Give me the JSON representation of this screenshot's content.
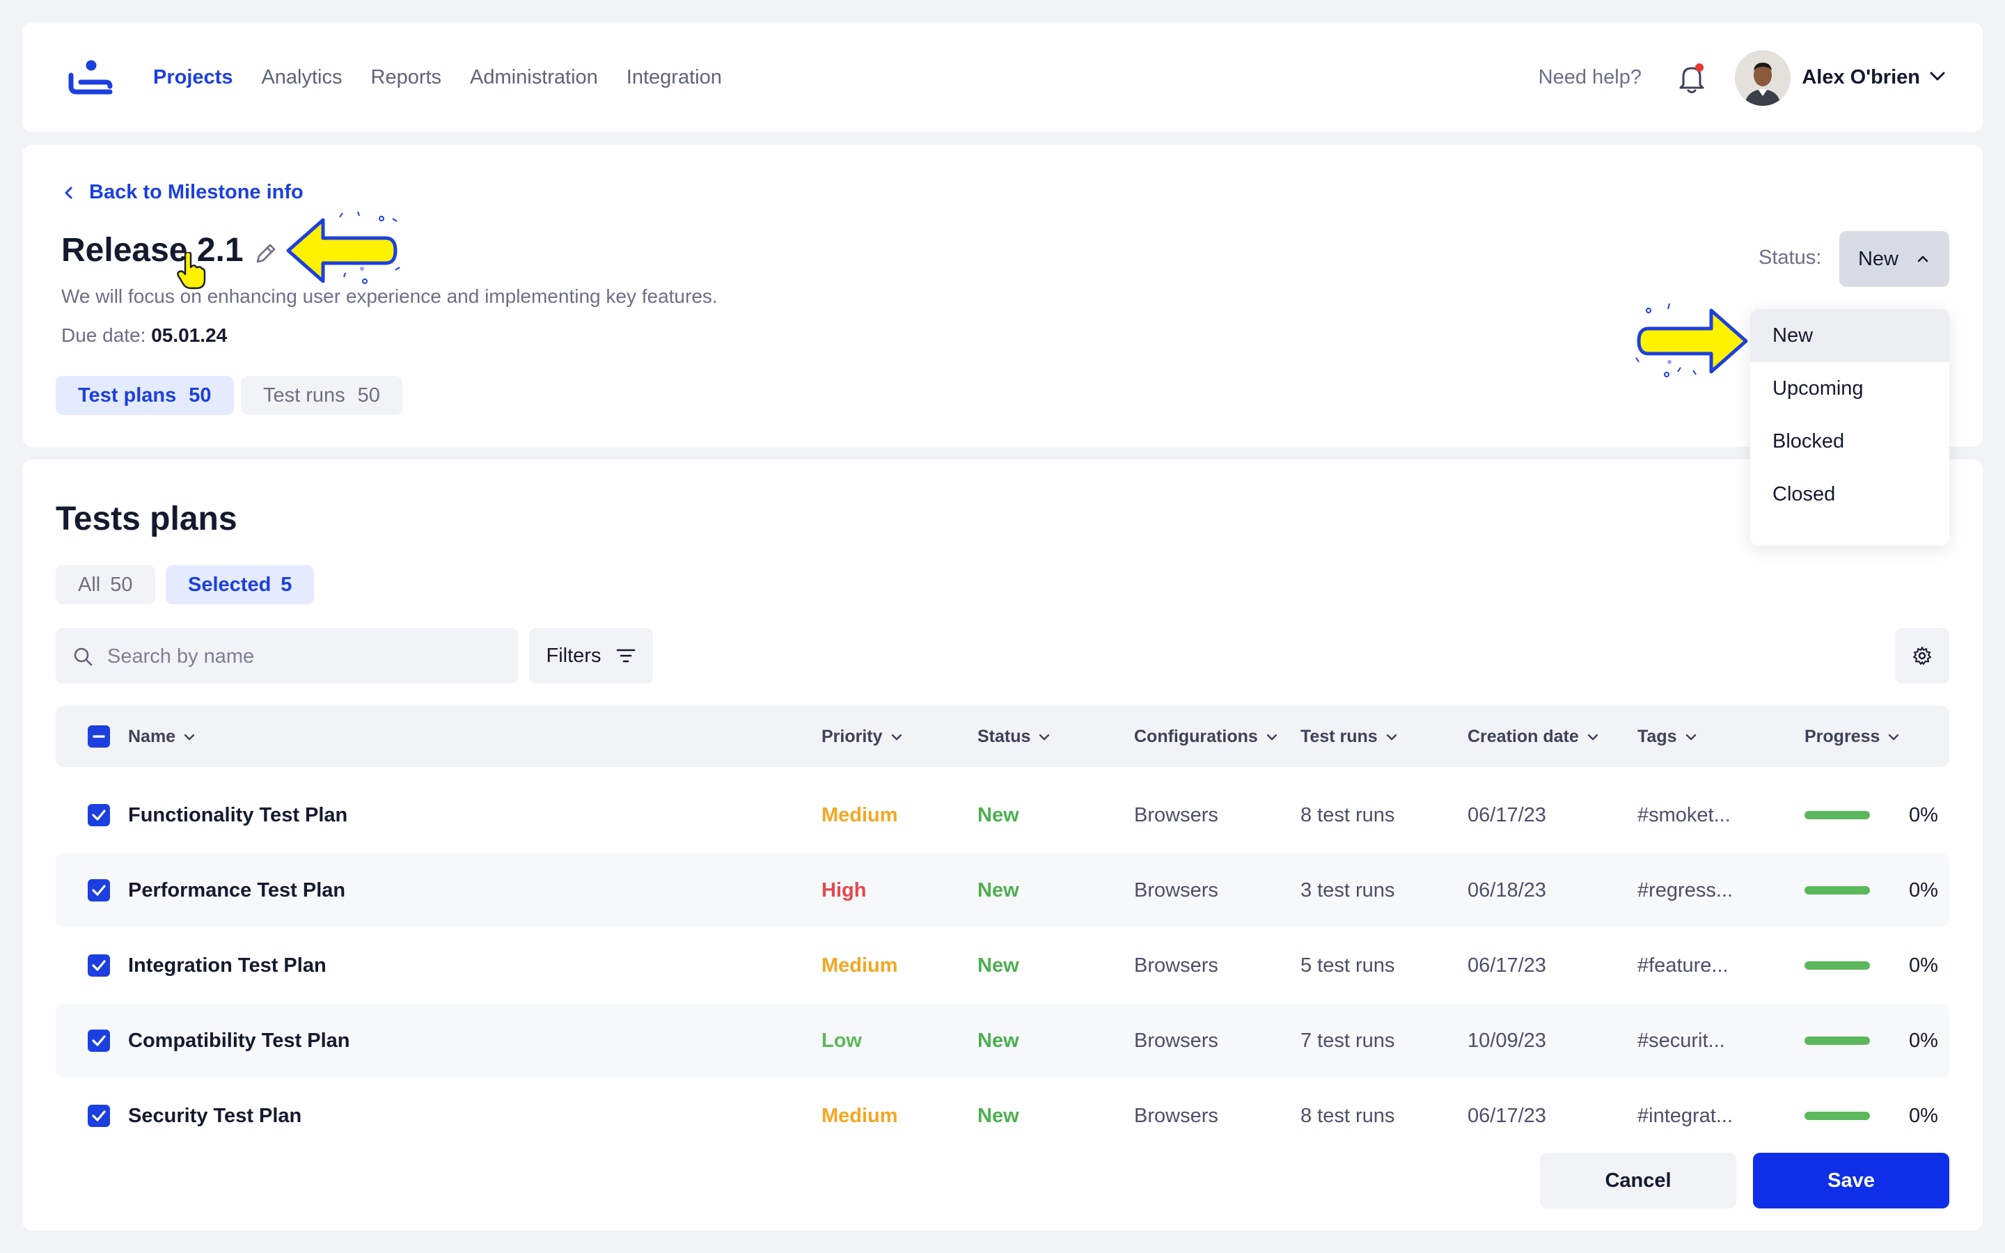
{
  "nav": {
    "items": [
      "Projects",
      "Analytics",
      "Reports",
      "Administration",
      "Integration"
    ],
    "active": "Projects"
  },
  "header": {
    "help": "Need help?",
    "user_name": "Alex O'brien",
    "notification_dot_color": "#e53935"
  },
  "milestone": {
    "back_label": "Back to Milestone info",
    "title": "Release 2.1",
    "description": "We will focus on enhancing user experience and implementing key features.",
    "due_label": "Due date:",
    "due_value": "05.01.24",
    "segments": [
      {
        "label": "Test plans",
        "count": "50"
      },
      {
        "label": "Test runs",
        "count": "50"
      }
    ],
    "status_label": "Status:",
    "status_value": "New"
  },
  "status_dropdown": {
    "options": [
      "New",
      "Upcoming",
      "Blocked",
      "Closed"
    ],
    "selected": "New"
  },
  "plans": {
    "title": "Tests plans",
    "tabs": [
      {
        "label": "All",
        "count": "50"
      },
      {
        "label": "Selected",
        "count": "5"
      }
    ],
    "search_placeholder": "Search by name",
    "filters_label": "Filters",
    "columns": [
      "Name",
      "Priority",
      "Status",
      "Configurations",
      "Test runs",
      "Creation date",
      "Tags",
      "Progress"
    ],
    "rows": [
      {
        "name": "Functionality Test Plan",
        "priority": "Medium",
        "status": "New",
        "config": "Browsers",
        "runs": "8 test runs",
        "date": "06/17/23",
        "tags": "#smoket...",
        "progress": "0%"
      },
      {
        "name": "Performance Test Plan",
        "priority": "High",
        "status": "New",
        "config": "Browsers",
        "runs": "3 test runs",
        "date": "06/18/23",
        "tags": "#regress...",
        "progress": "0%"
      },
      {
        "name": "Integration Test Plan",
        "priority": "Medium",
        "status": "New",
        "config": "Browsers",
        "runs": "5 test runs",
        "date": "06/17/23",
        "tags": "#feature...",
        "progress": "0%"
      },
      {
        "name": "Compatibility Test Plan",
        "priority": "Low",
        "status": "New",
        "config": "Browsers",
        "runs": "7 test runs",
        "date": "10/09/23",
        "tags": "#securit...",
        "progress": "0%"
      },
      {
        "name": "Security Test Plan",
        "priority": "Medium",
        "status": "New",
        "config": "Browsers",
        "runs": "8 test runs",
        "date": "06/17/23",
        "tags": "#integrat...",
        "progress": "0%"
      }
    ],
    "cancel_label": "Cancel",
    "save_label": "Save"
  },
  "colors": {
    "accent": "#1c3fe0",
    "medium": "#f5a623",
    "high": "#e5484d",
    "low": "#5cb85c",
    "status_new": "#4caf50",
    "annotation_arrow": "#fff200"
  }
}
